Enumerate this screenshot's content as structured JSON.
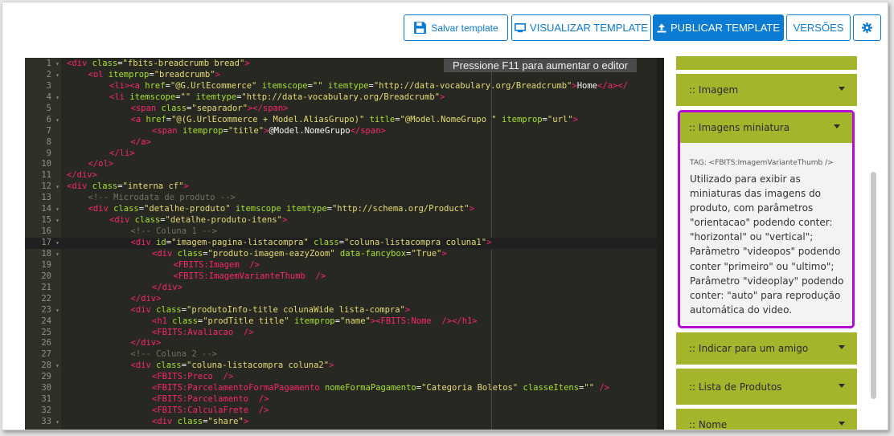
{
  "toolbar": {
    "save_label": "Salvar template",
    "view_label": "VISUALIZAR TEMPLATE",
    "publish_label": "PUBLICAR TEMPLATE",
    "versions_label": "VERSÕES",
    "icons": {
      "save": "floppy-disk-icon",
      "view": "monitor-icon",
      "publish": "upload-icon",
      "settings": "gear-icon"
    },
    "colors": {
      "primary": "#0c7bd4"
    }
  },
  "editor": {
    "tooltip": "Pressione F11 para aumentar o editor",
    "active_line": 17,
    "lines": [
      {
        "n": "1",
        "fold": true,
        "indent": 0,
        "parts": [
          [
            "tag",
            "<div "
          ],
          [
            "attr",
            "class"
          ],
          [
            "txt",
            "="
          ],
          [
            "str",
            "\"fbits-breadcrumb bread\""
          ],
          [
            "tag",
            ">"
          ]
        ]
      },
      {
        "n": "2",
        "fold": true,
        "indent": 1,
        "parts": [
          [
            "tag",
            "<ol "
          ],
          [
            "attr",
            "itemprop"
          ],
          [
            "txt",
            "="
          ],
          [
            "str",
            "\"breadcrumb\""
          ],
          [
            "tag",
            ">"
          ]
        ]
      },
      {
        "n": "3",
        "fold": false,
        "indent": 2,
        "parts": [
          [
            "tag",
            "<li>"
          ],
          [
            "tag",
            "<a "
          ],
          [
            "attr",
            "href"
          ],
          [
            "txt",
            "="
          ],
          [
            "str",
            "\"@G.UrlEcommerce\""
          ],
          [
            "txt",
            " "
          ],
          [
            "attr",
            "itemscope"
          ],
          [
            "txt",
            "="
          ],
          [
            "str",
            "\"\""
          ],
          [
            "txt",
            " "
          ],
          [
            "attr",
            "itemtype"
          ],
          [
            "txt",
            "="
          ],
          [
            "str",
            "\"http://data-vocabulary.org/Breadcrumb\""
          ],
          [
            "tag",
            ">"
          ],
          [
            "txt",
            "Home"
          ],
          [
            "tag",
            "</a>"
          ],
          [
            "tag",
            "</"
          ]
        ]
      },
      {
        "n": "4",
        "fold": true,
        "indent": 2,
        "parts": [
          [
            "tag",
            "<li "
          ],
          [
            "attr",
            "itemscope"
          ],
          [
            "txt",
            "="
          ],
          [
            "str",
            "\"\""
          ],
          [
            "txt",
            " "
          ],
          [
            "attr",
            "itemtype"
          ],
          [
            "txt",
            "="
          ],
          [
            "str",
            "\"http://data-vocabulary.org/Breadcrumb\""
          ],
          [
            "tag",
            ">"
          ]
        ]
      },
      {
        "n": "5",
        "fold": false,
        "indent": 3,
        "parts": [
          [
            "tag",
            "<span "
          ],
          [
            "attr",
            "class"
          ],
          [
            "txt",
            "="
          ],
          [
            "str",
            "\"separador\""
          ],
          [
            "tag",
            "></span>"
          ]
        ]
      },
      {
        "n": "6",
        "fold": true,
        "indent": 3,
        "parts": [
          [
            "tag",
            "<a "
          ],
          [
            "attr",
            "href"
          ],
          [
            "txt",
            "="
          ],
          [
            "str",
            "\"@(G.UrlEcommerce + Model.AliasGrupo)\""
          ],
          [
            "txt",
            " "
          ],
          [
            "attr",
            "title"
          ],
          [
            "txt",
            "="
          ],
          [
            "str",
            "\"@Model.NomeGrupo \""
          ],
          [
            "txt",
            " "
          ],
          [
            "attr",
            "itemprop"
          ],
          [
            "txt",
            "="
          ],
          [
            "str",
            "\"url\""
          ],
          [
            "tag",
            ">"
          ]
        ]
      },
      {
        "n": "7",
        "fold": false,
        "indent": 4,
        "parts": [
          [
            "tag",
            "<span "
          ],
          [
            "attr",
            "itemprop"
          ],
          [
            "txt",
            "="
          ],
          [
            "str",
            "\"title\""
          ],
          [
            "tag",
            ">"
          ],
          [
            "txt",
            "@Model.NomeGrupo"
          ],
          [
            "tag",
            "</span>"
          ]
        ]
      },
      {
        "n": "8",
        "fold": false,
        "indent": 3,
        "parts": [
          [
            "tag",
            "</a>"
          ]
        ]
      },
      {
        "n": "9",
        "fold": false,
        "indent": 2,
        "parts": [
          [
            "tag",
            "</li>"
          ]
        ]
      },
      {
        "n": "10",
        "fold": false,
        "indent": 1,
        "parts": [
          [
            "tag",
            "</ol>"
          ]
        ]
      },
      {
        "n": "11",
        "fold": false,
        "indent": 0,
        "parts": [
          [
            "tag",
            "</div>"
          ]
        ]
      },
      {
        "n": "12",
        "fold": true,
        "indent": 0,
        "parts": [
          [
            "tag",
            "<div "
          ],
          [
            "attr",
            "class"
          ],
          [
            "txt",
            "="
          ],
          [
            "str",
            "\"interna cf\""
          ],
          [
            "tag",
            ">"
          ]
        ]
      },
      {
        "n": "13",
        "fold": false,
        "indent": 1,
        "parts": [
          [
            "com",
            "<!-- Microdata de produto -->"
          ]
        ]
      },
      {
        "n": "14",
        "fold": true,
        "indent": 1,
        "parts": [
          [
            "tag",
            "<div "
          ],
          [
            "attr",
            "class"
          ],
          [
            "txt",
            "="
          ],
          [
            "str",
            "\"detalhe-produto\""
          ],
          [
            "txt",
            " "
          ],
          [
            "attr",
            "itemscope"
          ],
          [
            "txt",
            " "
          ],
          [
            "attr",
            "itemtype"
          ],
          [
            "txt",
            "="
          ],
          [
            "str",
            "\"http://schema.org/Product\""
          ],
          [
            "tag",
            ">"
          ]
        ]
      },
      {
        "n": "15",
        "fold": true,
        "indent": 2,
        "parts": [
          [
            "tag",
            "<div "
          ],
          [
            "attr",
            "class"
          ],
          [
            "txt",
            "="
          ],
          [
            "str",
            "\"detalhe-produto-itens\""
          ],
          [
            "tag",
            ">"
          ]
        ]
      },
      {
        "n": "16",
        "fold": false,
        "indent": 3,
        "parts": [
          [
            "com",
            "<!-- Coluna 1 -->"
          ]
        ]
      },
      {
        "n": "17",
        "fold": true,
        "indent": 3,
        "parts": [
          [
            "tag",
            "<div "
          ],
          [
            "attr",
            "id"
          ],
          [
            "txt",
            "="
          ],
          [
            "str",
            "\"imagem-pagina-listacompra\""
          ],
          [
            "txt",
            " "
          ],
          [
            "attr",
            "class"
          ],
          [
            "txt",
            "="
          ],
          [
            "str",
            "\"coluna-listacompra coluna1\""
          ],
          [
            "tag",
            ">"
          ]
        ]
      },
      {
        "n": "18",
        "fold": true,
        "indent": 4,
        "parts": [
          [
            "tag",
            "<div "
          ],
          [
            "attr",
            "class"
          ],
          [
            "txt",
            "="
          ],
          [
            "str",
            "\"produto-imagem-eazyZoom\""
          ],
          [
            "txt",
            " "
          ],
          [
            "attr",
            "data-fancybox"
          ],
          [
            "txt",
            "="
          ],
          [
            "str",
            "\"True\""
          ],
          [
            "tag",
            ">"
          ]
        ]
      },
      {
        "n": "19",
        "fold": false,
        "indent": 5,
        "parts": [
          [
            "tag",
            "<FBITS:Imagem"
          ],
          [
            "txt",
            "  "
          ],
          [
            "tag",
            "/>"
          ]
        ]
      },
      {
        "n": "20",
        "fold": false,
        "indent": 5,
        "parts": [
          [
            "tag",
            "<FBITS:ImagemVarianteThumb"
          ],
          [
            "txt",
            "  "
          ],
          [
            "tag",
            "/>"
          ]
        ]
      },
      {
        "n": "21",
        "fold": false,
        "indent": 4,
        "parts": [
          [
            "tag",
            "</div>"
          ]
        ]
      },
      {
        "n": "22",
        "fold": false,
        "indent": 3,
        "parts": [
          [
            "tag",
            "</div>"
          ]
        ]
      },
      {
        "n": "23",
        "fold": true,
        "indent": 3,
        "parts": [
          [
            "tag",
            "<div "
          ],
          [
            "attr",
            "class"
          ],
          [
            "txt",
            "="
          ],
          [
            "str",
            "\"produtoInfo-title colunaWide lista-compra\""
          ],
          [
            "tag",
            ">"
          ]
        ]
      },
      {
        "n": "24",
        "fold": false,
        "indent": 4,
        "parts": [
          [
            "tag",
            "<h1 "
          ],
          [
            "attr",
            "class"
          ],
          [
            "txt",
            "="
          ],
          [
            "str",
            "\"prodTitle title\""
          ],
          [
            "txt",
            " "
          ],
          [
            "attr",
            "itemprop"
          ],
          [
            "txt",
            "="
          ],
          [
            "str",
            "\"name\""
          ],
          [
            "tag",
            ">"
          ],
          [
            "tag",
            "<FBITS:Nome"
          ],
          [
            "txt",
            "  "
          ],
          [
            "tag",
            "/>"
          ],
          [
            "tag",
            "</h1>"
          ]
        ]
      },
      {
        "n": "25",
        "fold": false,
        "indent": 4,
        "parts": [
          [
            "tag",
            "<FBITS:Avaliacao"
          ],
          [
            "txt",
            "  "
          ],
          [
            "tag",
            "/>"
          ]
        ]
      },
      {
        "n": "26",
        "fold": false,
        "indent": 3,
        "parts": [
          [
            "tag",
            "</div>"
          ]
        ]
      },
      {
        "n": "27",
        "fold": false,
        "indent": 3,
        "parts": [
          [
            "com",
            "<!-- Coluna 2 -->"
          ]
        ]
      },
      {
        "n": "28",
        "fold": true,
        "indent": 3,
        "parts": [
          [
            "tag",
            "<div "
          ],
          [
            "attr",
            "class"
          ],
          [
            "txt",
            "="
          ],
          [
            "str",
            "\"coluna-listacompra coluna2\""
          ],
          [
            "tag",
            ">"
          ]
        ]
      },
      {
        "n": "29",
        "fold": false,
        "indent": 4,
        "parts": [
          [
            "tag",
            "<FBITS:Preco"
          ],
          [
            "txt",
            "  "
          ],
          [
            "tag",
            "/>"
          ]
        ]
      },
      {
        "n": "30",
        "fold": false,
        "indent": 4,
        "parts": [
          [
            "tag",
            "<FBITS:ParcelamentoFormaPagamento "
          ],
          [
            "attr",
            "nomeFormaPagamento"
          ],
          [
            "txt",
            "="
          ],
          [
            "str",
            "\"Categoria Boletos\""
          ],
          [
            "txt",
            " "
          ],
          [
            "attr",
            "classeItens"
          ],
          [
            "txt",
            "="
          ],
          [
            "str",
            "\"\""
          ],
          [
            "txt",
            " "
          ],
          [
            "tag",
            "/>"
          ]
        ]
      },
      {
        "n": "31",
        "fold": false,
        "indent": 4,
        "parts": [
          [
            "tag",
            "<FBITS:Parcelamento"
          ],
          [
            "txt",
            "  "
          ],
          [
            "tag",
            "/>"
          ]
        ]
      },
      {
        "n": "32",
        "fold": false,
        "indent": 4,
        "parts": [
          [
            "tag",
            "<FBITS:CalculaFrete"
          ],
          [
            "txt",
            "  "
          ],
          [
            "tag",
            "/>"
          ]
        ]
      },
      {
        "n": "33",
        "fold": true,
        "indent": 4,
        "parts": [
          [
            "tag",
            "<div "
          ],
          [
            "attr",
            "class"
          ],
          [
            "txt",
            "="
          ],
          [
            "str",
            "\"share\""
          ],
          [
            "tag",
            ">"
          ]
        ]
      }
    ]
  },
  "panel": {
    "colors": {
      "header": "#a4b42b",
      "highlight": "#b30dd4"
    },
    "items": {
      "imagem": ":: Imagem",
      "imagens_miniatura": ":: Imagens miniatura",
      "indicar": ":: Indicar para um amigo",
      "lista": ":: Lista de Produtos",
      "nome": ":: Nome"
    },
    "expanded": {
      "tag": "TAG: <FBITS:ImagemVarianteThumb />",
      "description": "Utilizado para exibir as miniaturas das imagens do produto, com parâmetros \"orientacao\" podendo conter: \"horizontal\" ou \"vertical\"; Parâmetro \"videopos\" podendo conter \"primeiro\" ou \"ultimo\"; Parâmetro \"videoplay\" podendo conter: \"auto\" para reprodução automática do video."
    }
  }
}
